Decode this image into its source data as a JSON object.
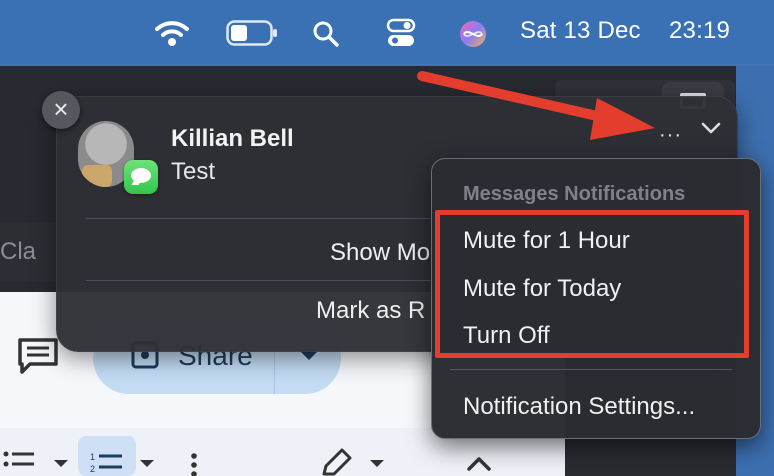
{
  "menubar": {
    "icons": [
      "wifi-icon",
      "battery-icon",
      "spotlight-search-icon",
      "control-center-icon",
      "siri-icon"
    ],
    "date": "Sat 13 Dec",
    "time": "23:19"
  },
  "background_app": {
    "partial_text": "Cla",
    "share_label": "Share",
    "icons": [
      "comment-icon",
      "bulleted-list-icon",
      "numbered-list-icon",
      "more-vertical-icon",
      "pen-icon",
      "chevron-up-icon",
      "sidebar-toggle-icon"
    ]
  },
  "notification": {
    "sender": "Killian Bell",
    "message": "Test",
    "app_icon": "messages-app-icon",
    "close_symbol": "×",
    "more_symbol": "···",
    "actions": [
      {
        "label": "Show Mo"
      },
      {
        "label": "Mark as R"
      }
    ]
  },
  "context_menu": {
    "header": "Messages Notifications",
    "items": [
      {
        "label": "Mute for 1 Hour"
      },
      {
        "label": "Mute for Today"
      },
      {
        "label": "Turn Off"
      }
    ],
    "footer_item": "Notification Settings..."
  },
  "annotation": {
    "color": "#e53d2d",
    "shapes": [
      "arrow",
      "highlight-box"
    ]
  }
}
